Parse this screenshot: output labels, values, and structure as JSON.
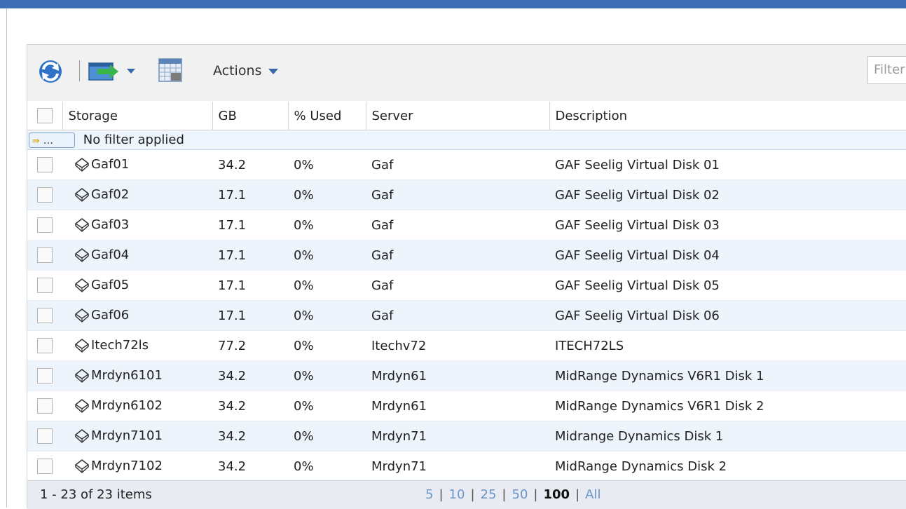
{
  "toolbar": {
    "actions_label": "Actions",
    "filter_placeholder": "Filter"
  },
  "table": {
    "headers": {
      "storage": "Storage",
      "gb": "GB",
      "used": "% Used",
      "server": "Server",
      "description": "Description"
    },
    "filter_status": "No filter applied",
    "filter_button_label": "...",
    "rows": [
      {
        "storage": "Gaf01",
        "gb": "34.2",
        "used": "0%",
        "server": "Gaf",
        "description": "GAF Seelig Virtual Disk 01"
      },
      {
        "storage": "Gaf02",
        "gb": "17.1",
        "used": "0%",
        "server": "Gaf",
        "description": "GAF Seelig Virtual Disk 02"
      },
      {
        "storage": "Gaf03",
        "gb": "17.1",
        "used": "0%",
        "server": "Gaf",
        "description": "GAF Seelig Virtual Disk 03"
      },
      {
        "storage": "Gaf04",
        "gb": "17.1",
        "used": "0%",
        "server": "Gaf",
        "description": "GAF Seelig Virtual Disk 04"
      },
      {
        "storage": "Gaf05",
        "gb": "17.1",
        "used": "0%",
        "server": "Gaf",
        "description": "GAF Seelig Virtual Disk 05"
      },
      {
        "storage": "Gaf06",
        "gb": "17.1",
        "used": "0%",
        "server": "Gaf",
        "description": "GAF Seelig Virtual Disk 06"
      },
      {
        "storage": "Itech72ls",
        "gb": "77.2",
        "used": "0%",
        "server": "Itechv72",
        "description": "ITECH72LS"
      },
      {
        "storage": "Mrdyn6101",
        "gb": "34.2",
        "used": "0%",
        "server": "Mrdyn61",
        "description": "MidRange Dynamics V6R1 Disk 1"
      },
      {
        "storage": "Mrdyn6102",
        "gb": "34.2",
        "used": "0%",
        "server": "Mrdyn61",
        "description": "MidRange Dynamics V6R1 Disk 2"
      },
      {
        "storage": "Mrdyn7101",
        "gb": "34.2",
        "used": "0%",
        "server": "Mrdyn71",
        "description": "Midrange Dynamics Disk 1"
      },
      {
        "storage": "Mrdyn7102",
        "gb": "34.2",
        "used": "0%",
        "server": "Mrdyn71",
        "description": "MidRange Dynamics Disk 2"
      }
    ]
  },
  "footer": {
    "count_text": "1 - 23 of 23 items",
    "page_sizes": [
      "5",
      "10",
      "25",
      "50",
      "100",
      "All"
    ],
    "current_page_size": "100"
  },
  "colors": {
    "titlebar": "#3e6fb5",
    "row_alt": "#eef4fb",
    "link": "#6a96c8"
  }
}
